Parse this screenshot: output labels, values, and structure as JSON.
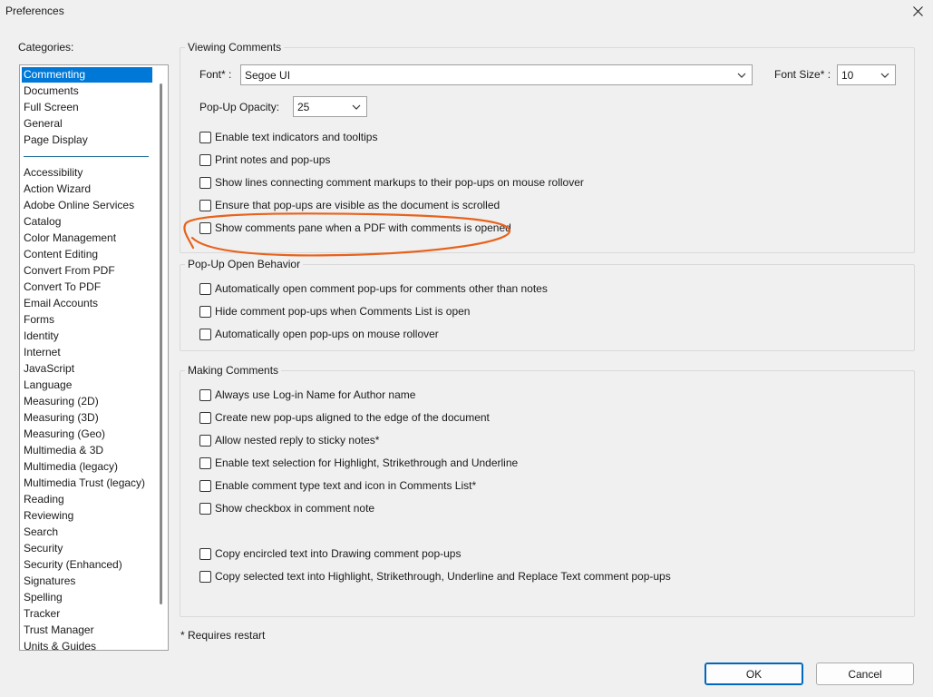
{
  "window": {
    "title": "Preferences",
    "close_icon": "close-icon"
  },
  "categories": {
    "label": "Categories:",
    "top_items": [
      "Commenting",
      "Documents",
      "Full Screen",
      "General",
      "Page Display"
    ],
    "items": [
      "Accessibility",
      "Action Wizard",
      "Adobe Online Services",
      "Catalog",
      "Color Management",
      "Content Editing",
      "Convert From PDF",
      "Convert To PDF",
      "Email Accounts",
      "Forms",
      "Identity",
      "Internet",
      "JavaScript",
      "Language",
      "Measuring (2D)",
      "Measuring (3D)",
      "Measuring (Geo)",
      "Multimedia & 3D",
      "Multimedia (legacy)",
      "Multimedia Trust (legacy)",
      "Reading",
      "Reviewing",
      "Search",
      "Security",
      "Security (Enhanced)",
      "Signatures",
      "Spelling",
      "Tracker",
      "Trust Manager",
      "Units & Guides"
    ],
    "selected": "Commenting"
  },
  "viewing": {
    "title": "Viewing Comments",
    "font_label": "Font* :",
    "font_value": "Segoe UI",
    "font_size_label": "Font Size* :",
    "font_size_value": "10",
    "opacity_label": "Pop-Up Opacity:",
    "opacity_value": "25",
    "options": [
      "Enable text indicators and tooltips",
      "Print notes and pop-ups",
      "Show lines connecting comment markups to their pop-ups on mouse rollover",
      "Ensure that pop-ups are visible as the document is scrolled",
      "Show comments pane when a PDF with comments is opened"
    ]
  },
  "popup_behavior": {
    "title": "Pop-Up Open Behavior",
    "options": [
      "Automatically open comment pop-ups for comments other than notes",
      "Hide comment pop-ups when Comments List is open",
      "Automatically open pop-ups on mouse rollover"
    ]
  },
  "making": {
    "title": "Making Comments",
    "options": [
      "Always use Log-in Name for Author name",
      "Create new pop-ups aligned to the edge of the document",
      "Allow nested reply to sticky notes*",
      "Enable text selection for Highlight, Strikethrough and Underline",
      "Enable comment type text and icon in Comments List*",
      "Show checkbox in comment note",
      "Copy encircled text into Drawing comment pop-ups",
      "Copy selected text into Highlight, Strikethrough, Underline and Replace Text comment pop-ups"
    ]
  },
  "footer": {
    "note": "* Requires restart",
    "ok_label": "OK",
    "cancel_label": "Cancel"
  },
  "colors": {
    "selection": "#0078d7",
    "annotation": "#e8621c",
    "default_button_border": "#0067c0"
  }
}
